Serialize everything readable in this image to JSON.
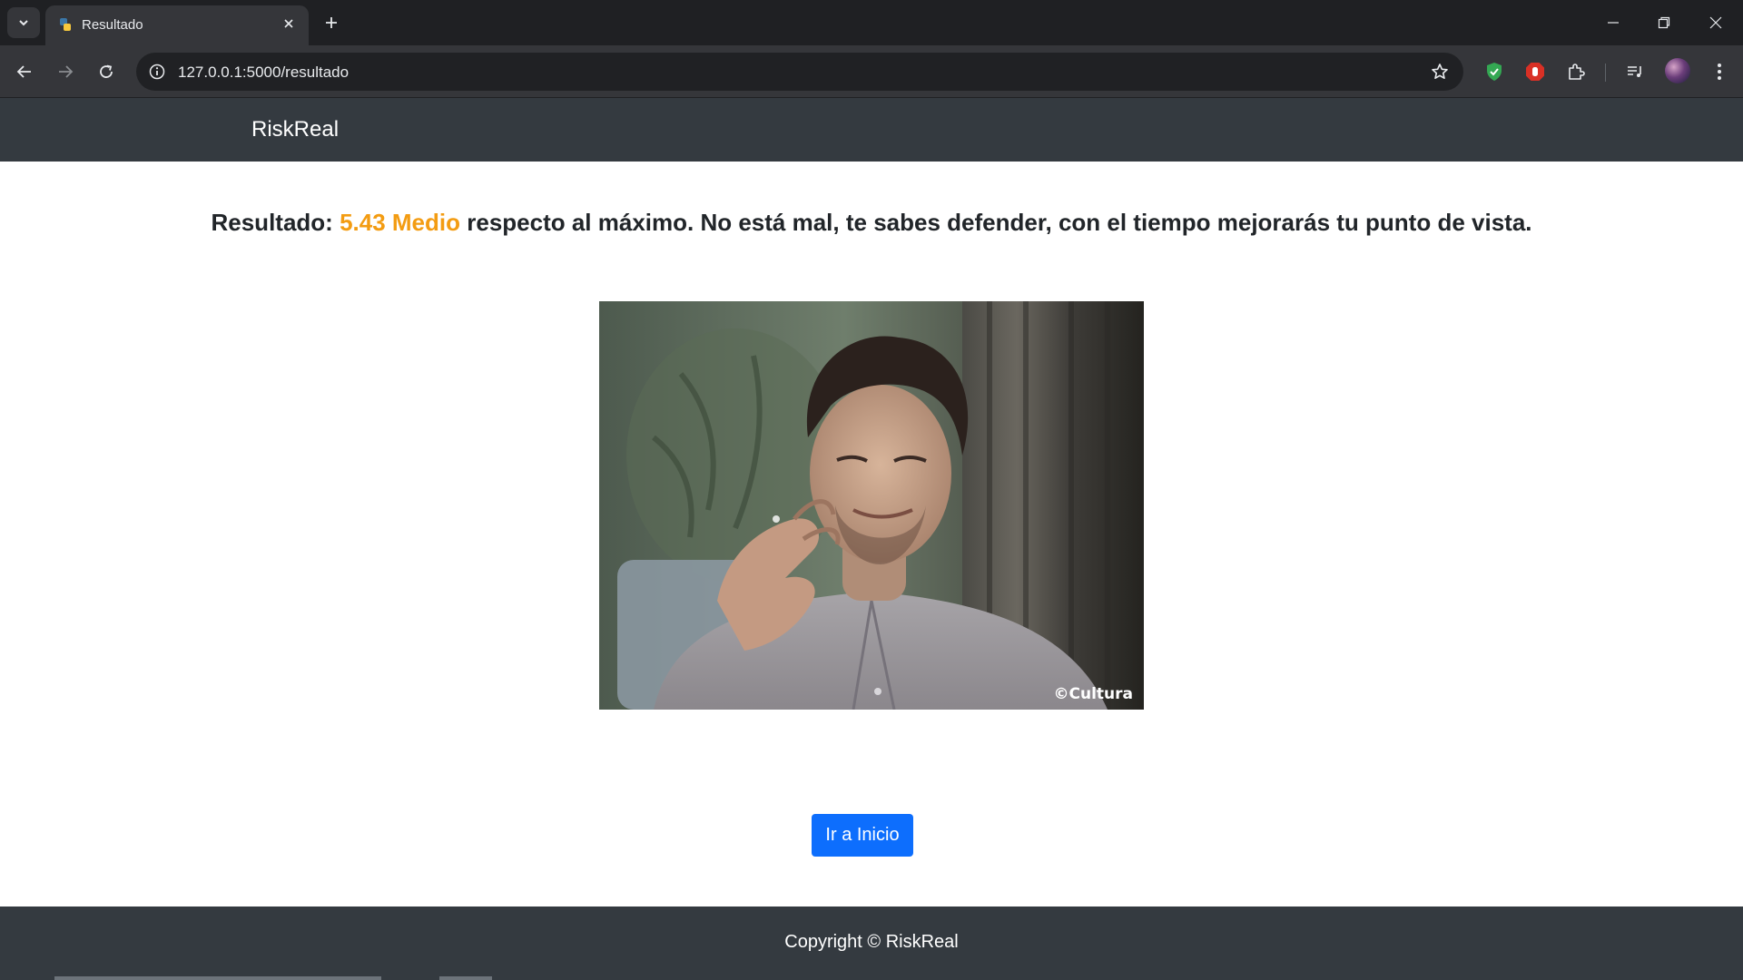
{
  "browser": {
    "tab_title": "Resultado",
    "url": "127.0.0.1:5000/resultado"
  },
  "icons": {
    "tab_search": "chevron-down-icon",
    "favicon": "python-icon",
    "tab_close": "close-icon",
    "new_tab": "plus-icon",
    "back": "arrow-left-icon",
    "forward": "arrow-right-icon",
    "reload": "reload-icon",
    "site_info": "info-icon",
    "bookmark": "star-icon",
    "ext_shield": "shield-check-icon",
    "ext_block": "stop-hand-icon",
    "extensions": "puzzle-icon",
    "media": "media-queue-icon",
    "menu": "kebab-menu-icon"
  },
  "site": {
    "brand": "RiskReal"
  },
  "result": {
    "label": "Resultado:",
    "score": "5.43 Medio",
    "message": "respecto al máximo. No está mal, te sabes defender, con el tiempo mejorarás tu punto de vista.",
    "score_color": "#f39c12"
  },
  "image": {
    "watermark": "©Cultura"
  },
  "button": {
    "home_label": "Ir a Inicio",
    "color": "#0d6efd"
  },
  "footer": {
    "copyright": "Copyright © RiskReal"
  }
}
